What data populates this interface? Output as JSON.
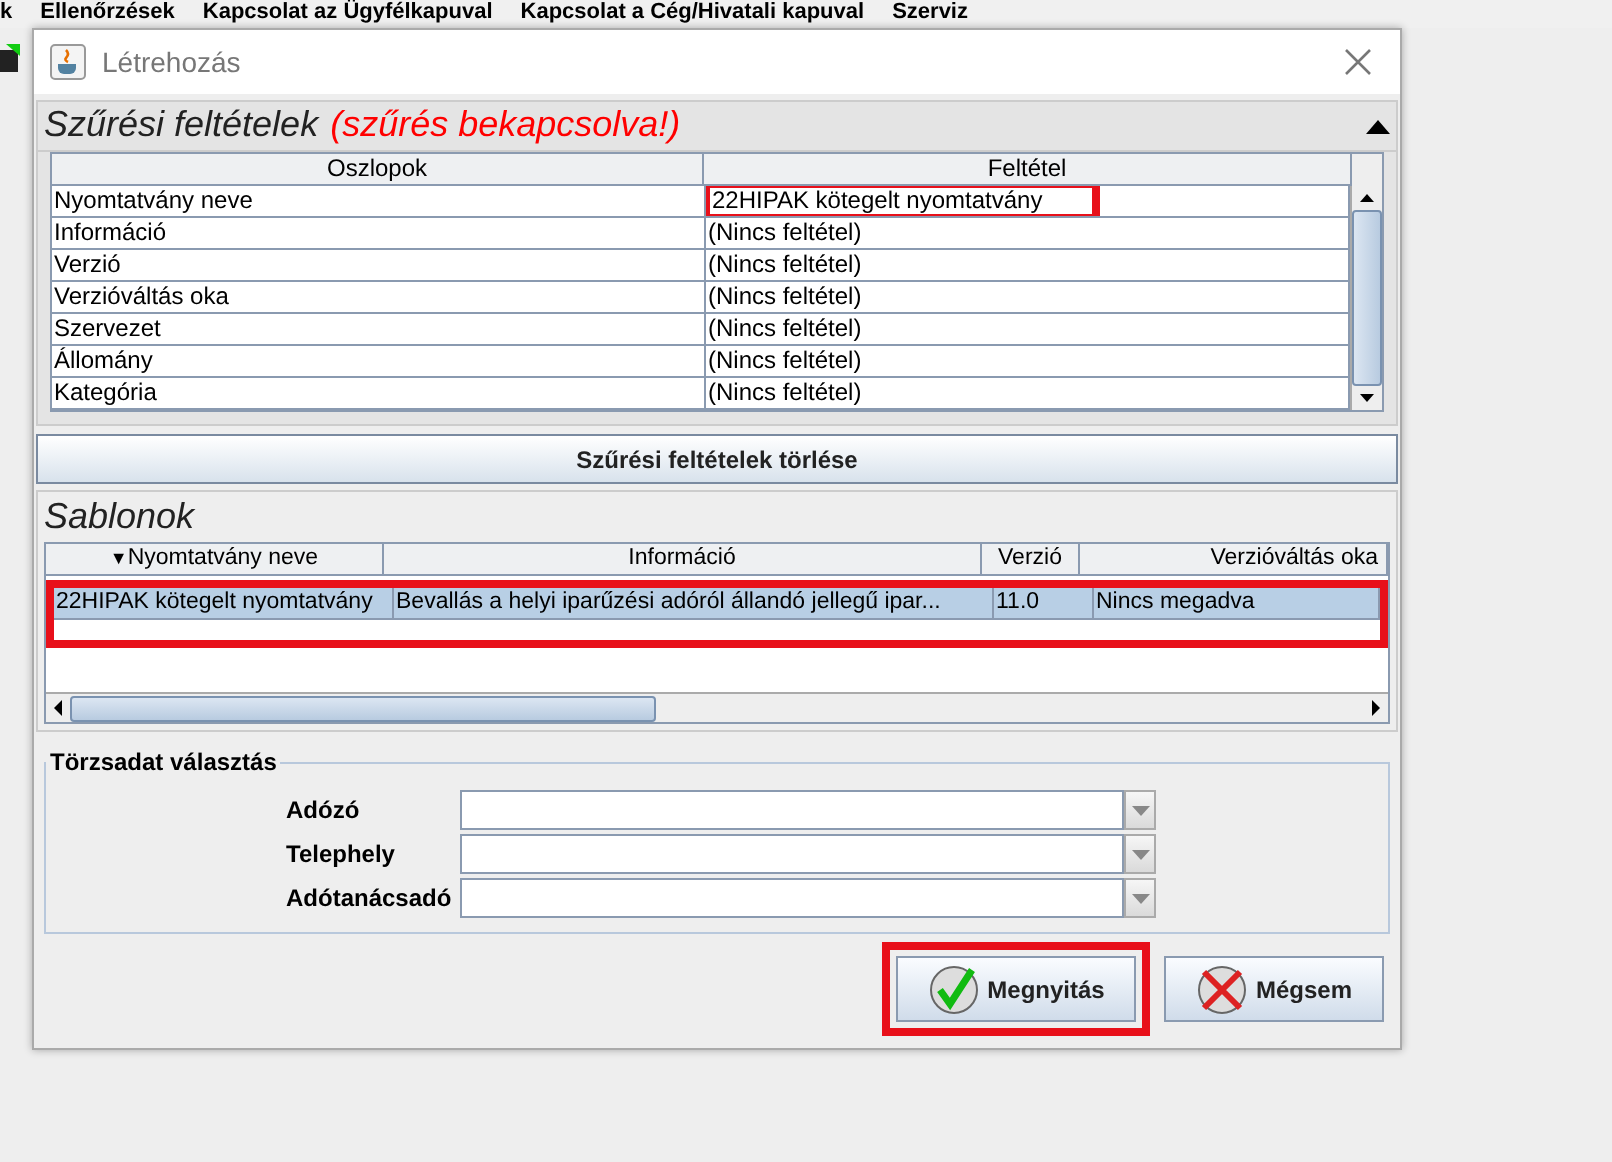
{
  "menu_bar": [
    "k",
    "Ellenőrzések",
    "Kapcsolat az Ügyfélkapuval",
    "Kapcsolat a Cég/Hivatali kapuval",
    "Szerviz"
  ],
  "dialog": {
    "title": "Létrehozás"
  },
  "filter_panel": {
    "title": "Szűrési feltételek",
    "status": "(szűrés bekapcsolva!)",
    "expanded": true,
    "columns": [
      "Oszlopok",
      "Feltétel"
    ],
    "rows": [
      {
        "column": "Nyomtatvány neve",
        "condition": "22HIPAK kötegelt nyomtatvány",
        "highlighted": true
      },
      {
        "column": "Információ",
        "condition": "(Nincs feltétel)",
        "highlighted": false
      },
      {
        "column": "Verzió",
        "condition": "(Nincs feltétel)",
        "highlighted": false
      },
      {
        "column": "Verzióváltás oka",
        "condition": "(Nincs feltétel)",
        "highlighted": false
      },
      {
        "column": "Szervezet",
        "condition": "(Nincs feltétel)",
        "highlighted": false
      },
      {
        "column": "Állomány",
        "condition": "(Nincs feltétel)",
        "highlighted": false
      },
      {
        "column": "Kategória",
        "condition": "(Nincs feltétel)",
        "highlighted": false
      }
    ],
    "clear_button": "Szűrési feltételek törlése"
  },
  "templates": {
    "title": "Sablonok",
    "sort_indicator": "▼",
    "columns": [
      "Nyomtatvány neve",
      "Információ",
      "Verzió",
      "Verzióváltás oka"
    ],
    "rows": [
      {
        "cells": [
          "22HIPAK kötegelt nyomtatvány",
          "Bevallás a helyi iparűzési adóról állandó jellegű ipar...",
          "11.0",
          "Nincs megadva"
        ],
        "selected": true,
        "highlighted": true
      }
    ]
  },
  "master_data": {
    "title": "Törzsadat választás",
    "fields": [
      {
        "label": "Adózó"
      },
      {
        "label": "Telephely"
      },
      {
        "label": "Adótanácsadó"
      }
    ]
  },
  "buttons": [
    {
      "kind": "ok",
      "label": "Megnyitás",
      "highlighted": true
    },
    {
      "kind": "cancel",
      "label": "Mégsem",
      "highlighted": false
    }
  ]
}
